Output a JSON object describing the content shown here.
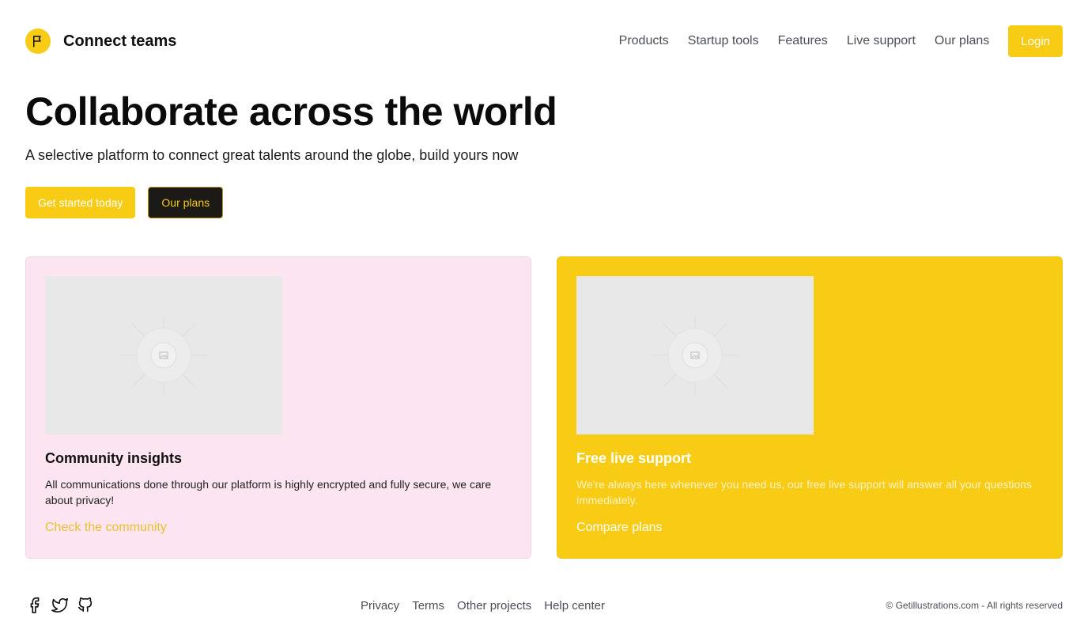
{
  "brand": {
    "name": "Connect teams",
    "logo_icon": "flag-icon",
    "accent": "#f8cb15"
  },
  "nav": {
    "items": [
      {
        "label": "Products"
      },
      {
        "label": "Startup tools"
      },
      {
        "label": "Features"
      },
      {
        "label": "Live support"
      },
      {
        "label": "Our plans"
      }
    ],
    "login_label": "Login"
  },
  "hero": {
    "title": "Collaborate across the world",
    "subtitle": "A selective platform to connect great talents around the globe, build yours now",
    "primary_cta": "Get started today",
    "secondary_cta": "Our plans"
  },
  "cards": [
    {
      "title": "Community insights",
      "text": "All communications done through our platform is highly encrypted and fully secure, we care about privacy!",
      "link": "Check the community",
      "background": "#fce4f0",
      "image_icon": "image-placeholder-icon"
    },
    {
      "title": "Free live support",
      "text": "We're always here whenever you need us, our free live support will answer all your questions immediately.",
      "link": "Compare plans",
      "background": "#f8cb15",
      "image_icon": "image-placeholder-icon"
    }
  ],
  "footer": {
    "social": [
      {
        "icon": "facebook-icon"
      },
      {
        "icon": "twitter-icon"
      },
      {
        "icon": "github-icon"
      }
    ],
    "links": [
      {
        "label": "Privacy"
      },
      {
        "label": "Terms"
      },
      {
        "label": "Other projects"
      },
      {
        "label": "Help center"
      }
    ],
    "copyright": "© Getillustrations.com - All rights reserved"
  }
}
